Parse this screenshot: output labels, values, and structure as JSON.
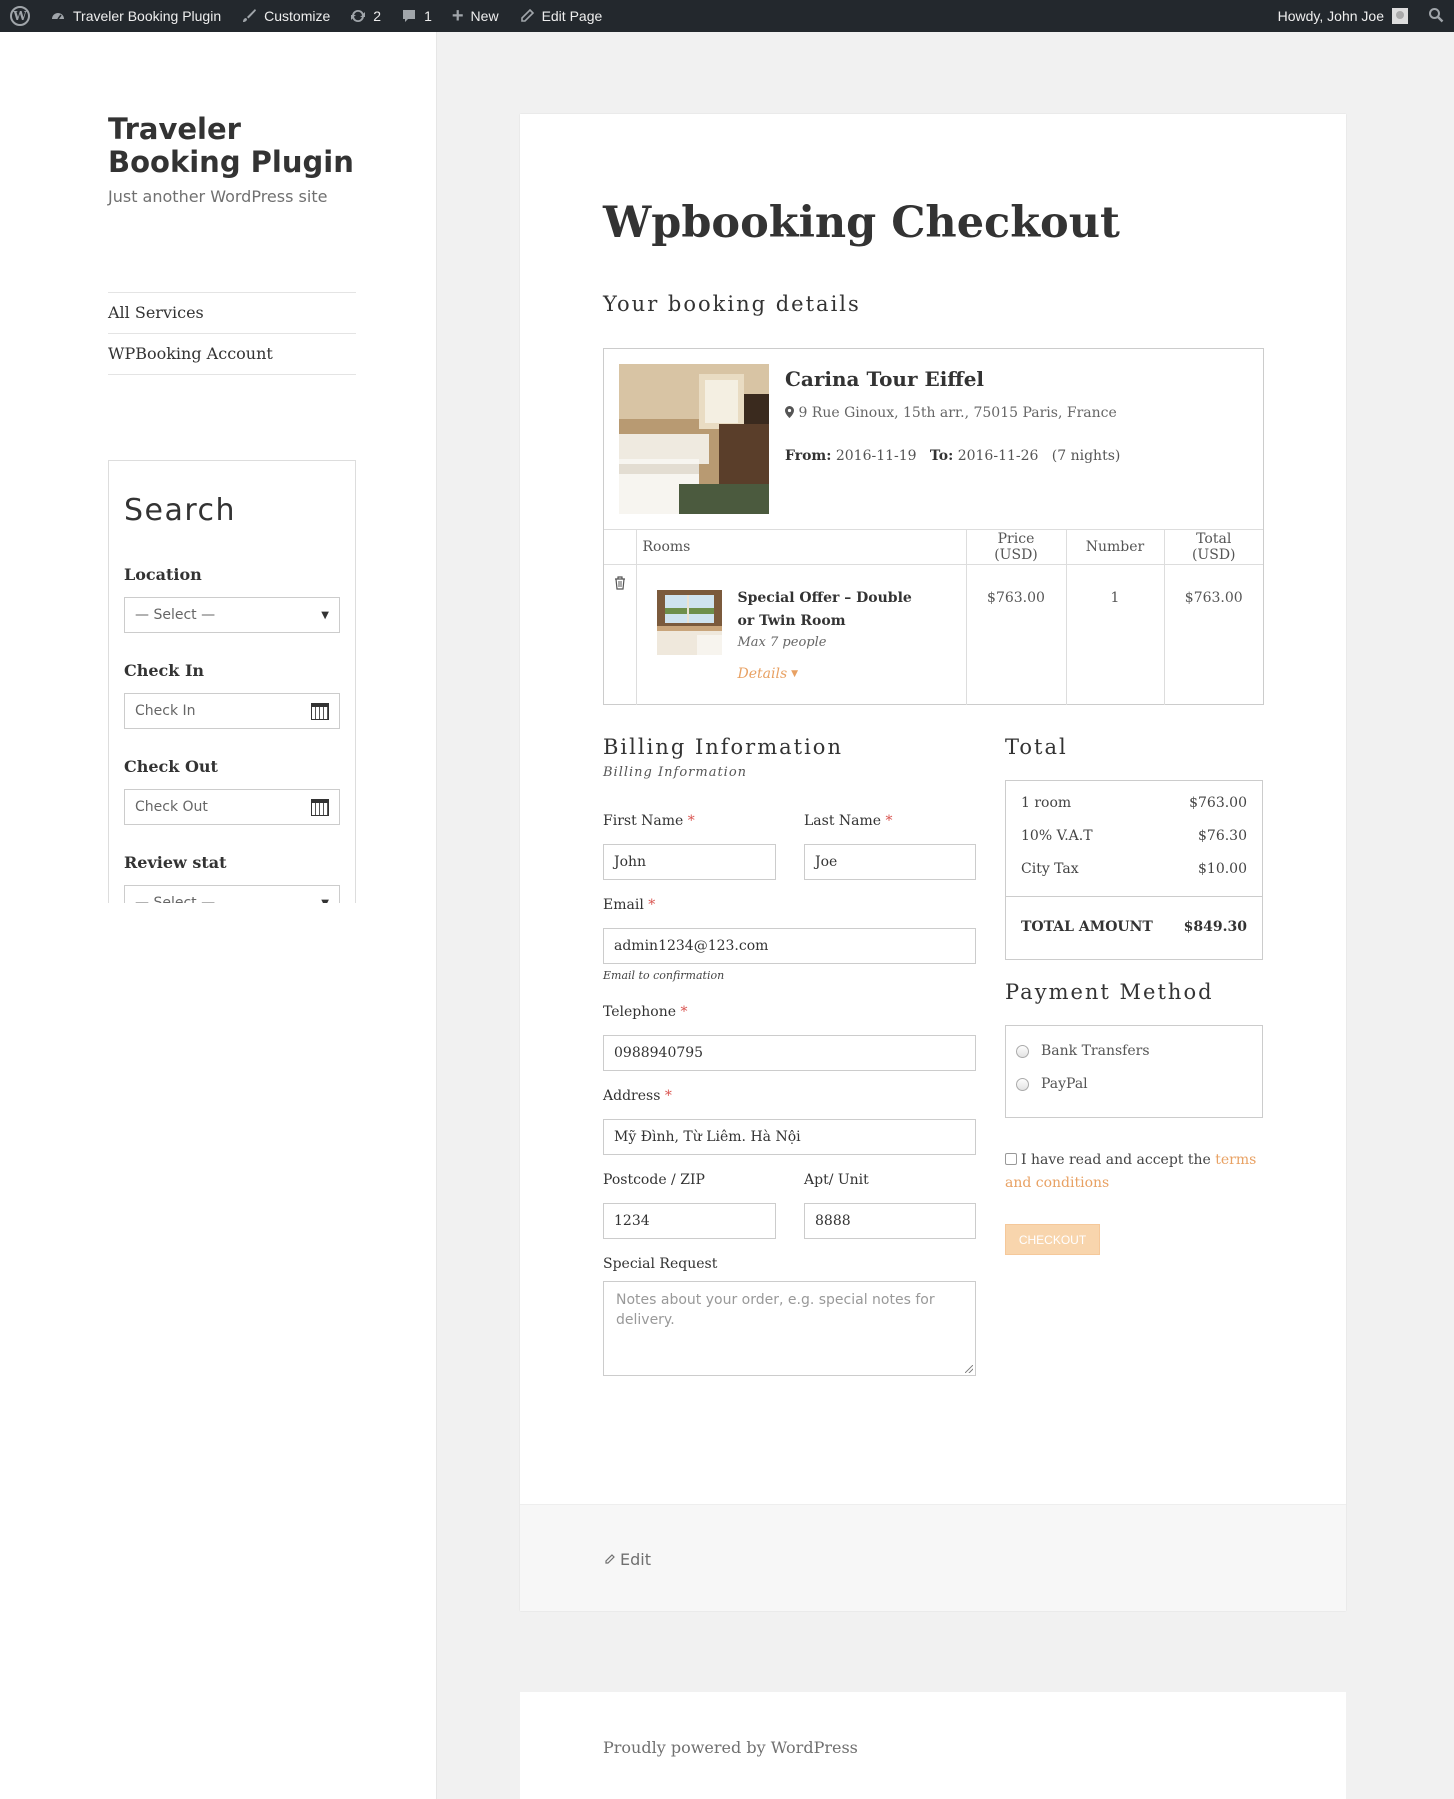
{
  "adminbar": {
    "site_name": "Traveler Booking Plugin",
    "customize": "Customize",
    "updates_count": "2",
    "comments_count": "1",
    "new_label": "New",
    "edit_page": "Edit Page",
    "howdy": "Howdy, John Joe"
  },
  "sidebar": {
    "site_title": "Traveler Booking Plugin",
    "site_desc": "Just another WordPress site",
    "menu": [
      "All Services",
      "WPBooking Account"
    ],
    "search": {
      "title": "Search",
      "location_label": "Location",
      "location_value": "— Select —",
      "checkin_label": "Check In",
      "checkin_placeholder": "Check In",
      "checkout_label": "Check Out",
      "checkout_placeholder": "Check Out",
      "review_label": "Review stat",
      "review_value": "— Select —"
    }
  },
  "main": {
    "page_title": "Wpbooking Checkout",
    "booking_details_title": "Your booking details",
    "hotel": {
      "name": "Carina Tour Eiffel",
      "address": "9 Rue Ginoux, 15th arr., 75015 Paris, France",
      "from_label": "From:",
      "from": "2016-11-19",
      "to_label": "To:",
      "to": "2016-11-26",
      "nights": "(7 nights)"
    },
    "rooms_table": {
      "headers": [
        "Rooms",
        "Price (USD)",
        "Number",
        "Total (USD)"
      ],
      "rows": [
        {
          "name": "Special Offer – Double or Twin Room",
          "max": "Max 7 people",
          "details": "Details",
          "price": "$763.00",
          "number": "1",
          "total": "$763.00"
        }
      ]
    },
    "billing": {
      "title": "Billing Information",
      "subtitle": "Billing Information",
      "first_name_label": "First Name",
      "first_name": "John",
      "last_name_label": "Last Name",
      "last_name": "Joe",
      "email_label": "Email",
      "email": "admin1234@123.com",
      "email_hint": "Email to confirmation",
      "telephone_label": "Telephone",
      "telephone": "0988940795",
      "address_label": "Address",
      "address": "Mỹ Đình, Từ Liêm. Hà Nội",
      "postcode_label": "Postcode / ZIP",
      "postcode": "1234",
      "apt_label": "Apt/ Unit",
      "apt": "8888",
      "special_label": "Special Request",
      "special_placeholder": "Notes about your order, e.g. special notes for delivery.",
      "required_mark": "*"
    },
    "total": {
      "title": "Total",
      "rows": [
        {
          "label": "1 room",
          "value": "$763.00"
        },
        {
          "label": "10% V.A.T",
          "value": "$76.30"
        },
        {
          "label": "City Tax",
          "value": "$10.00"
        }
      ],
      "total_label": "TOTAL AMOUNT",
      "total_value": "$849.30"
    },
    "payment": {
      "title": "Payment Method",
      "options": [
        "Bank Transfers",
        "PayPal"
      ]
    },
    "terms_text": "I have read and accept the",
    "terms_link": "terms and conditions",
    "checkout_btn": "CHECKOUT",
    "edit_link": "Edit"
  },
  "footer": {
    "powered": "Proudly powered by WordPress"
  },
  "colors": {
    "accent": "#e8a163",
    "adminbar": "#23282d",
    "checkout_btn": "#f8d5ad"
  }
}
